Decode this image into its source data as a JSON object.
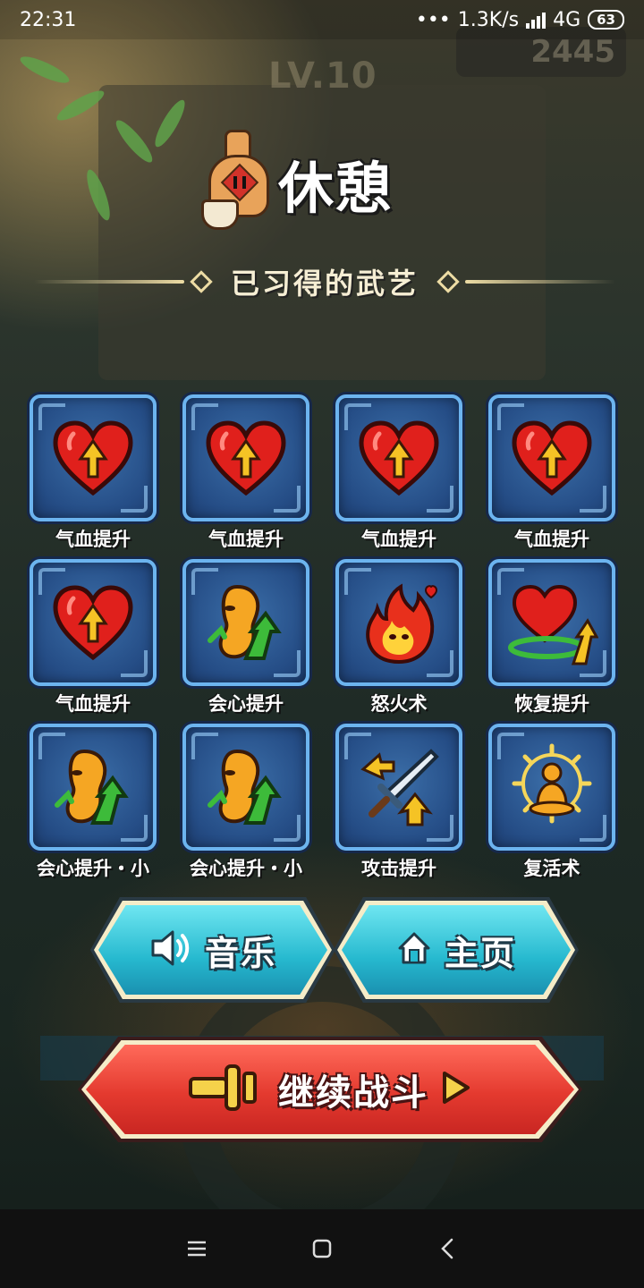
{
  "status_bar": {
    "time": "22:31",
    "dots": "•••",
    "net_speed": "1.3K/s",
    "network": "4G",
    "battery": "63"
  },
  "background": {
    "level_text": "LV.10",
    "score_text": "2445"
  },
  "screen": {
    "title": "休憩",
    "section_title": "已习得的武艺"
  },
  "skills": [
    {
      "label": "气血提升",
      "icon": "heart-up-icon"
    },
    {
      "label": "气血提升",
      "icon": "heart-up-icon"
    },
    {
      "label": "气血提升",
      "icon": "heart-up-icon"
    },
    {
      "label": "气血提升",
      "icon": "heart-up-icon"
    },
    {
      "label": "气血提升",
      "icon": "heart-up-icon"
    },
    {
      "label": "会心提升",
      "icon": "critical-up-icon"
    },
    {
      "label": "怒火术",
      "icon": "rage-fire-icon"
    },
    {
      "label": "恢复提升",
      "icon": "recovery-up-icon"
    },
    {
      "label": "会心提升・小",
      "icon": "critical-up-icon"
    },
    {
      "label": "会心提升・小",
      "icon": "critical-up-icon"
    },
    {
      "label": "攻击提升",
      "icon": "sword-up-icon"
    },
    {
      "label": "复活术",
      "icon": "revive-icon"
    }
  ],
  "buttons": {
    "music": "音乐",
    "home": "主页",
    "continue": "继续战斗"
  },
  "colors": {
    "tile_border": "#6cb4ef",
    "cyan_button": "#26b9cf",
    "red_button": "#e43a2f"
  }
}
